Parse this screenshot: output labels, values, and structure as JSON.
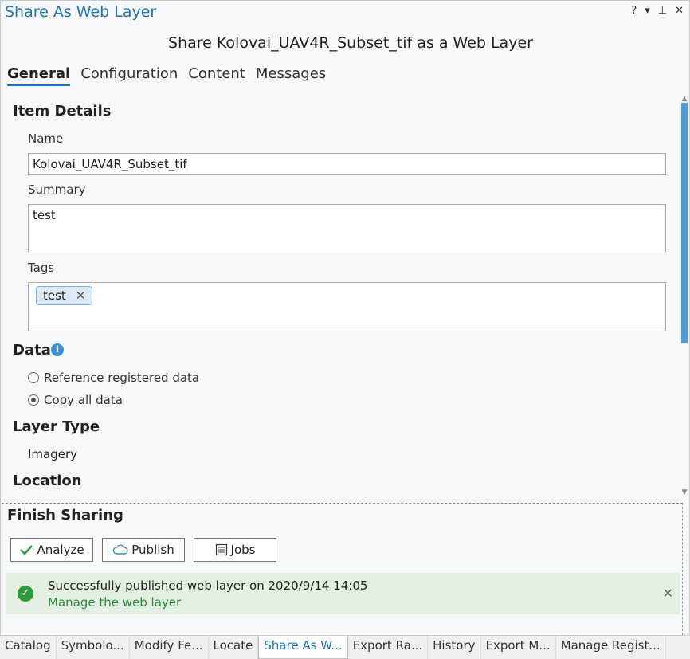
{
  "pane": {
    "title": "Share As Web Layer",
    "help_label": "?",
    "menu_label": "▾",
    "pin_label": "⊥",
    "close_label": "✕"
  },
  "heading": "Share Kolovai_UAV4R_Subset_tif as a Web Layer",
  "tabs": [
    "General",
    "Configuration",
    "Content",
    "Messages"
  ],
  "active_tab": "General",
  "item_details": {
    "heading": "Item Details",
    "name_label": "Name",
    "name_value": "Kolovai_UAV4R_Subset_tif",
    "summary_label": "Summary",
    "summary_value": "test",
    "tags_label": "Tags",
    "tags": [
      "test"
    ]
  },
  "data_section": {
    "heading": "Data",
    "options": [
      "Reference registered data",
      "Copy all data"
    ],
    "selected": "Copy all data"
  },
  "layer_type": {
    "heading": "Layer Type",
    "value": "Imagery"
  },
  "location": {
    "heading": "Location"
  },
  "finish": {
    "heading": "Finish Sharing",
    "analyze_label": "Analyze",
    "publish_label": "Publish",
    "jobs_label": "Jobs",
    "message": "Successfully published web layer on 2020/9/14 14:05",
    "manage_link": "Manage the web layer"
  },
  "bottom_tabs": [
    "Catalog",
    "Symbolo...",
    "Modify Fe...",
    "Locate",
    "Share As W...",
    "Export Ra...",
    "History",
    "Export M...",
    "Manage Regist..."
  ],
  "active_bottom_tab": "Share As W...",
  "colors": {
    "accent": "#1a75c7",
    "success": "#2e9b3c",
    "success_bg": "#e4efe4"
  }
}
